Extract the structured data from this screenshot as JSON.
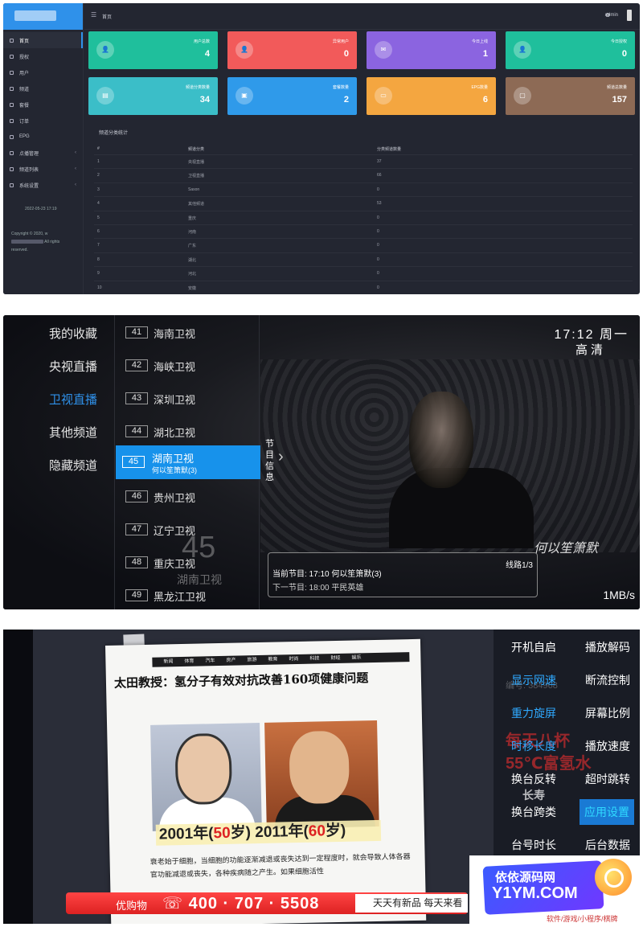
{
  "admin": {
    "header": {
      "title": "首页",
      "user": "admin"
    },
    "sidebar": {
      "items": [
        {
          "label": "首页",
          "active": true
        },
        {
          "label": "授权"
        },
        {
          "label": "用户"
        },
        {
          "label": "频道"
        },
        {
          "label": "套餐"
        },
        {
          "label": "订单"
        },
        {
          "label": "EPG"
        },
        {
          "label": "点播管理",
          "arrow": "‹"
        },
        {
          "label": "频道列表",
          "arrow": "‹"
        },
        {
          "label": "系统设置",
          "arrow": "‹"
        }
      ],
      "datetime": "2022-05-23 17:19",
      "copyright_a": "Copyright © 2020, w",
      "copyright_b": "All rights",
      "copyright_c": "reserved."
    },
    "cards": [
      {
        "label": "用户总数",
        "value": "4",
        "color": "#1fbf9c"
      },
      {
        "label": "异常用户",
        "value": "0",
        "color": "#f25a5a"
      },
      {
        "label": "今日上线",
        "value": "1",
        "color": "#8b64e0"
      },
      {
        "label": "今日授权",
        "value": "0",
        "color": "#1fbf9c"
      },
      {
        "label": "频道分类数量",
        "value": "34",
        "color": "#3bbec8"
      },
      {
        "label": "套餐数量",
        "value": "2",
        "color": "#2f9aea"
      },
      {
        "label": "EPG数量",
        "value": "6",
        "color": "#f4a640"
      },
      {
        "label": "频道总数量",
        "value": "157",
        "color": "#8d6a55"
      }
    ],
    "section_title": "频道分类统计",
    "table": {
      "headers": [
        "#",
        "频道分类",
        "分类频道数量"
      ],
      "rows": [
        [
          "1",
          "央视直播",
          "37"
        ],
        [
          "2",
          "卫视直播",
          "66"
        ],
        [
          "3",
          "Sason",
          "0"
        ],
        [
          "4",
          "其他频道",
          "53"
        ],
        [
          "5",
          "重庆",
          "0"
        ],
        [
          "6",
          "河南",
          "0"
        ],
        [
          "7",
          "广东",
          "0"
        ],
        [
          "8",
          "湖北",
          "0"
        ],
        [
          "9",
          "河北",
          "0"
        ],
        [
          "10",
          "安徽",
          "0"
        ]
      ]
    }
  },
  "tv": {
    "categories": [
      "我的收藏",
      "央视直播",
      "卫视直播",
      "其他频道",
      "隐藏频道"
    ],
    "active_category": "卫视直播",
    "channels": [
      {
        "num": "41",
        "name": "海南卫视"
      },
      {
        "num": "42",
        "name": "海峡卫视"
      },
      {
        "num": "43",
        "name": "深圳卫视"
      },
      {
        "num": "44",
        "name": "湖北卫视"
      },
      {
        "num": "46",
        "name": "贵州卫视"
      },
      {
        "num": "47",
        "name": "辽宁卫视"
      },
      {
        "num": "48",
        "name": "重庆卫视"
      },
      {
        "num": "49",
        "name": "黑龙江卫视"
      }
    ],
    "selected": {
      "num": "45",
      "name": "湖南卫视",
      "program": "何以笙箫默(3)"
    },
    "program_info": "节目信息",
    "time": "17:12 周一",
    "quality": "高清",
    "overlay_num": "45",
    "overlay_name": "湖南卫视",
    "current_program": "当前节目: 17:10 何以笙箫默(3)",
    "next_program": "下一节目: 18:00 平民英雄",
    "line": "线路1/3",
    "speed": "1MB/s",
    "watermark_script": "何以笙箫默"
  },
  "settings": {
    "paper": {
      "nav": [
        "新闻",
        "体育",
        "汽车",
        "房产",
        "旅游",
        "教育",
        "时尚",
        "科技",
        "财经",
        "娱乐"
      ],
      "title": "太田教授：氢分子有效对抗改善160项健康问题",
      "year_caption_a": "2001年(",
      "year_caption_a2": "50",
      "year_caption_a3": "岁)",
      "year_caption_b": "2011年(",
      "year_caption_b2": "60",
      "year_caption_b3": "岁)",
      "body": "衰老始于细胞，当细胞的功能逐渐减退或丧失达到一定程度时，就会导致人体各器官功能减退或丧失，各种疾病随之产生。如果细胞活性"
    },
    "menu_left": [
      "开机自启",
      "显示网速",
      "重力旋屏",
      "时移长度",
      "换台反转",
      "换台跨类",
      "台号时长"
    ],
    "menu_right": [
      "播放解码",
      "断流控制",
      "屏幕比例",
      "播放速度",
      "超时跳转",
      "应用设置",
      "后台数据"
    ],
    "active_right": "应用设置",
    "ghost": {
      "a": "每天八杯",
      "b": "55℃富氢水",
      "c": "长寿",
      "d": "编号: 384968"
    },
    "promo": {
      "label": "优购物",
      "phone": "☏ 400 · 707 · 5508",
      "slogan": "天天有新品 每天来看"
    },
    "watermark": {
      "name": "依依源码网",
      "domain": "Y1YM.COM",
      "tagline": "软件/游戏/小程序/棋牌"
    }
  }
}
